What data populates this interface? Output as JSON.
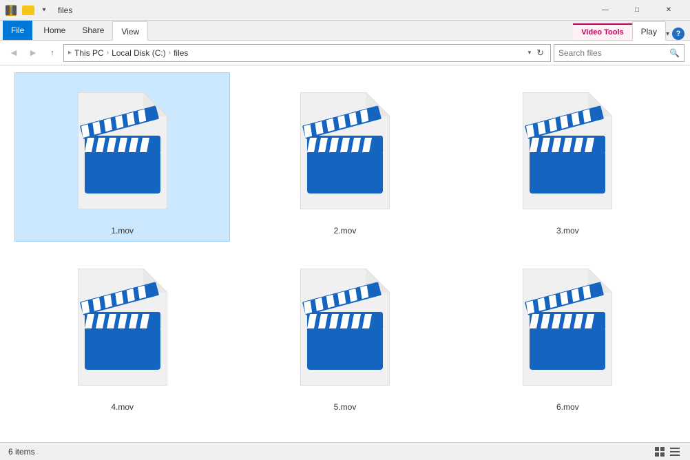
{
  "titleBar": {
    "title": "files",
    "minimizeLabel": "—",
    "maximizeLabel": "□",
    "closeLabel": "✕"
  },
  "ribbon": {
    "tabs": [
      {
        "id": "file",
        "label": "File",
        "type": "file"
      },
      {
        "id": "home",
        "label": "Home",
        "type": "normal"
      },
      {
        "id": "share",
        "label": "Share",
        "type": "normal"
      },
      {
        "id": "view",
        "label": "View",
        "type": "active"
      },
      {
        "id": "videotools",
        "label": "Video Tools",
        "type": "video-tools"
      },
      {
        "id": "play",
        "label": "Play",
        "type": "play-active"
      }
    ]
  },
  "addressBar": {
    "path": [
      "This PC",
      "Local Disk (C:)",
      "files"
    ],
    "searchPlaceholder": "Search files",
    "searchLabel": "Search"
  },
  "files": [
    {
      "id": 1,
      "name": "1.mov",
      "selected": true
    },
    {
      "id": 2,
      "name": "2.mov",
      "selected": false
    },
    {
      "id": 3,
      "name": "3.mov",
      "selected": false
    },
    {
      "id": 4,
      "name": "4.mov",
      "selected": false
    },
    {
      "id": 5,
      "name": "5.mov",
      "selected": false
    },
    {
      "id": 6,
      "name": "6.mov",
      "selected": false
    }
  ],
  "statusBar": {
    "itemCount": "6 items"
  }
}
